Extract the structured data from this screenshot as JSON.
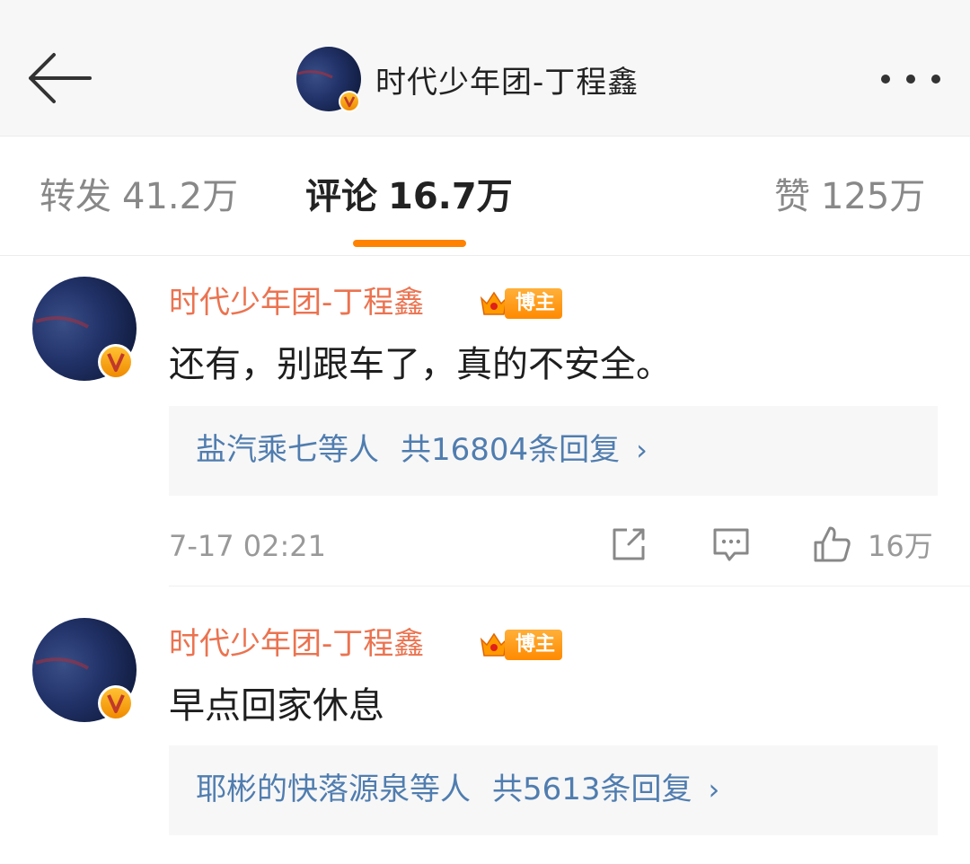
{
  "header": {
    "title": "时代少年团-丁程鑫",
    "back_icon": "back-arrow-icon",
    "more_icon": "more-dots-icon"
  },
  "tabs": [
    {
      "label": "转发",
      "count": "41.2万",
      "active": false
    },
    {
      "label": "评论",
      "count": "16.7万",
      "active": true
    },
    {
      "label": "赞",
      "count": "125万",
      "active": false
    }
  ],
  "colors": {
    "accent": "#ff8200",
    "username": "#eb7350",
    "reply_link": "#507daf",
    "verified": "#f5a623"
  },
  "comments": [
    {
      "username": "时代少年团-丁程鑫",
      "badge": "博主",
      "text": "还有，别跟车了，真的不安全。",
      "replies_users": "盐汽乘七等人",
      "replies_count": "共16804条回复",
      "time": "7-17 02:21",
      "likes": "16万"
    },
    {
      "username": "时代少年团-丁程鑫",
      "badge": "博主",
      "text": "早点回家休息",
      "replies_users": "耶彬的快落源泉等人",
      "replies_count": "共5613条回复"
    }
  ]
}
